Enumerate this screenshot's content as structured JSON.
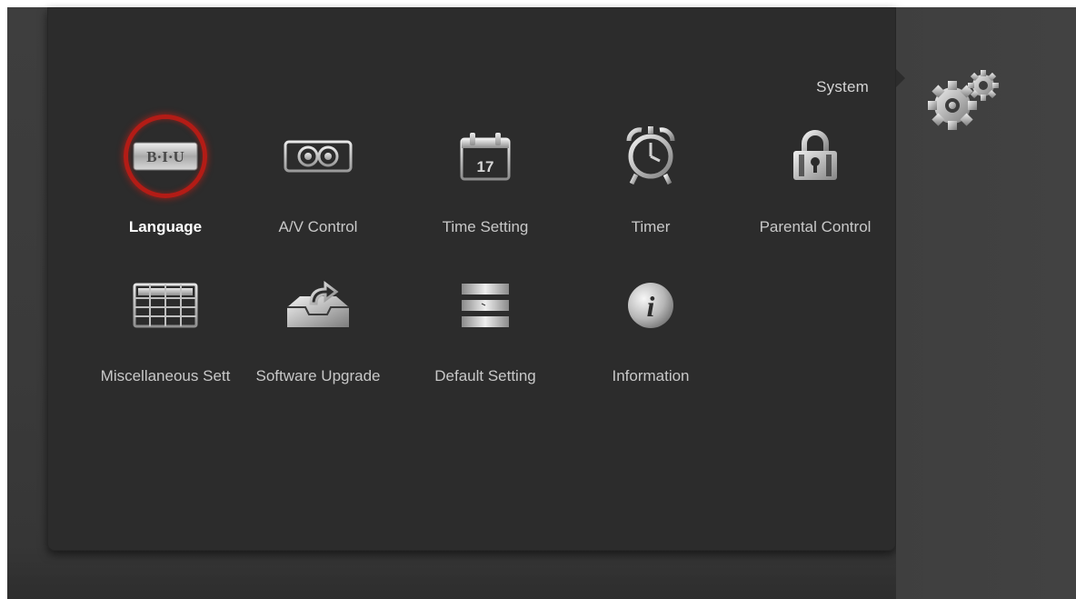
{
  "header": {
    "title": "System"
  },
  "menu": {
    "items": [
      {
        "label": "Language",
        "icon": "language-icon",
        "selected": true
      },
      {
        "label": "A/V Control",
        "icon": "av-control-icon"
      },
      {
        "label": "Time Setting",
        "icon": "calendar-icon",
        "calendar_day": "17"
      },
      {
        "label": "Timer",
        "icon": "alarm-clock-icon"
      },
      {
        "label": "Parental Control",
        "icon": "padlock-icon"
      },
      {
        "label": "Miscellaneous Sett",
        "icon": "grid-table-icon"
      },
      {
        "label": "Software Upgrade",
        "icon": "upgrade-tray-icon"
      },
      {
        "label": "Default Setting",
        "icon": "default-setting-icon"
      },
      {
        "label": "Information",
        "icon": "info-icon"
      }
    ],
    "language_icon_text": "B·I·U"
  },
  "colors": {
    "selection_ring": "#b31c16",
    "panel": "#2c2c2c",
    "label": "#c8c8c8",
    "selected_label": "#ffffff"
  }
}
